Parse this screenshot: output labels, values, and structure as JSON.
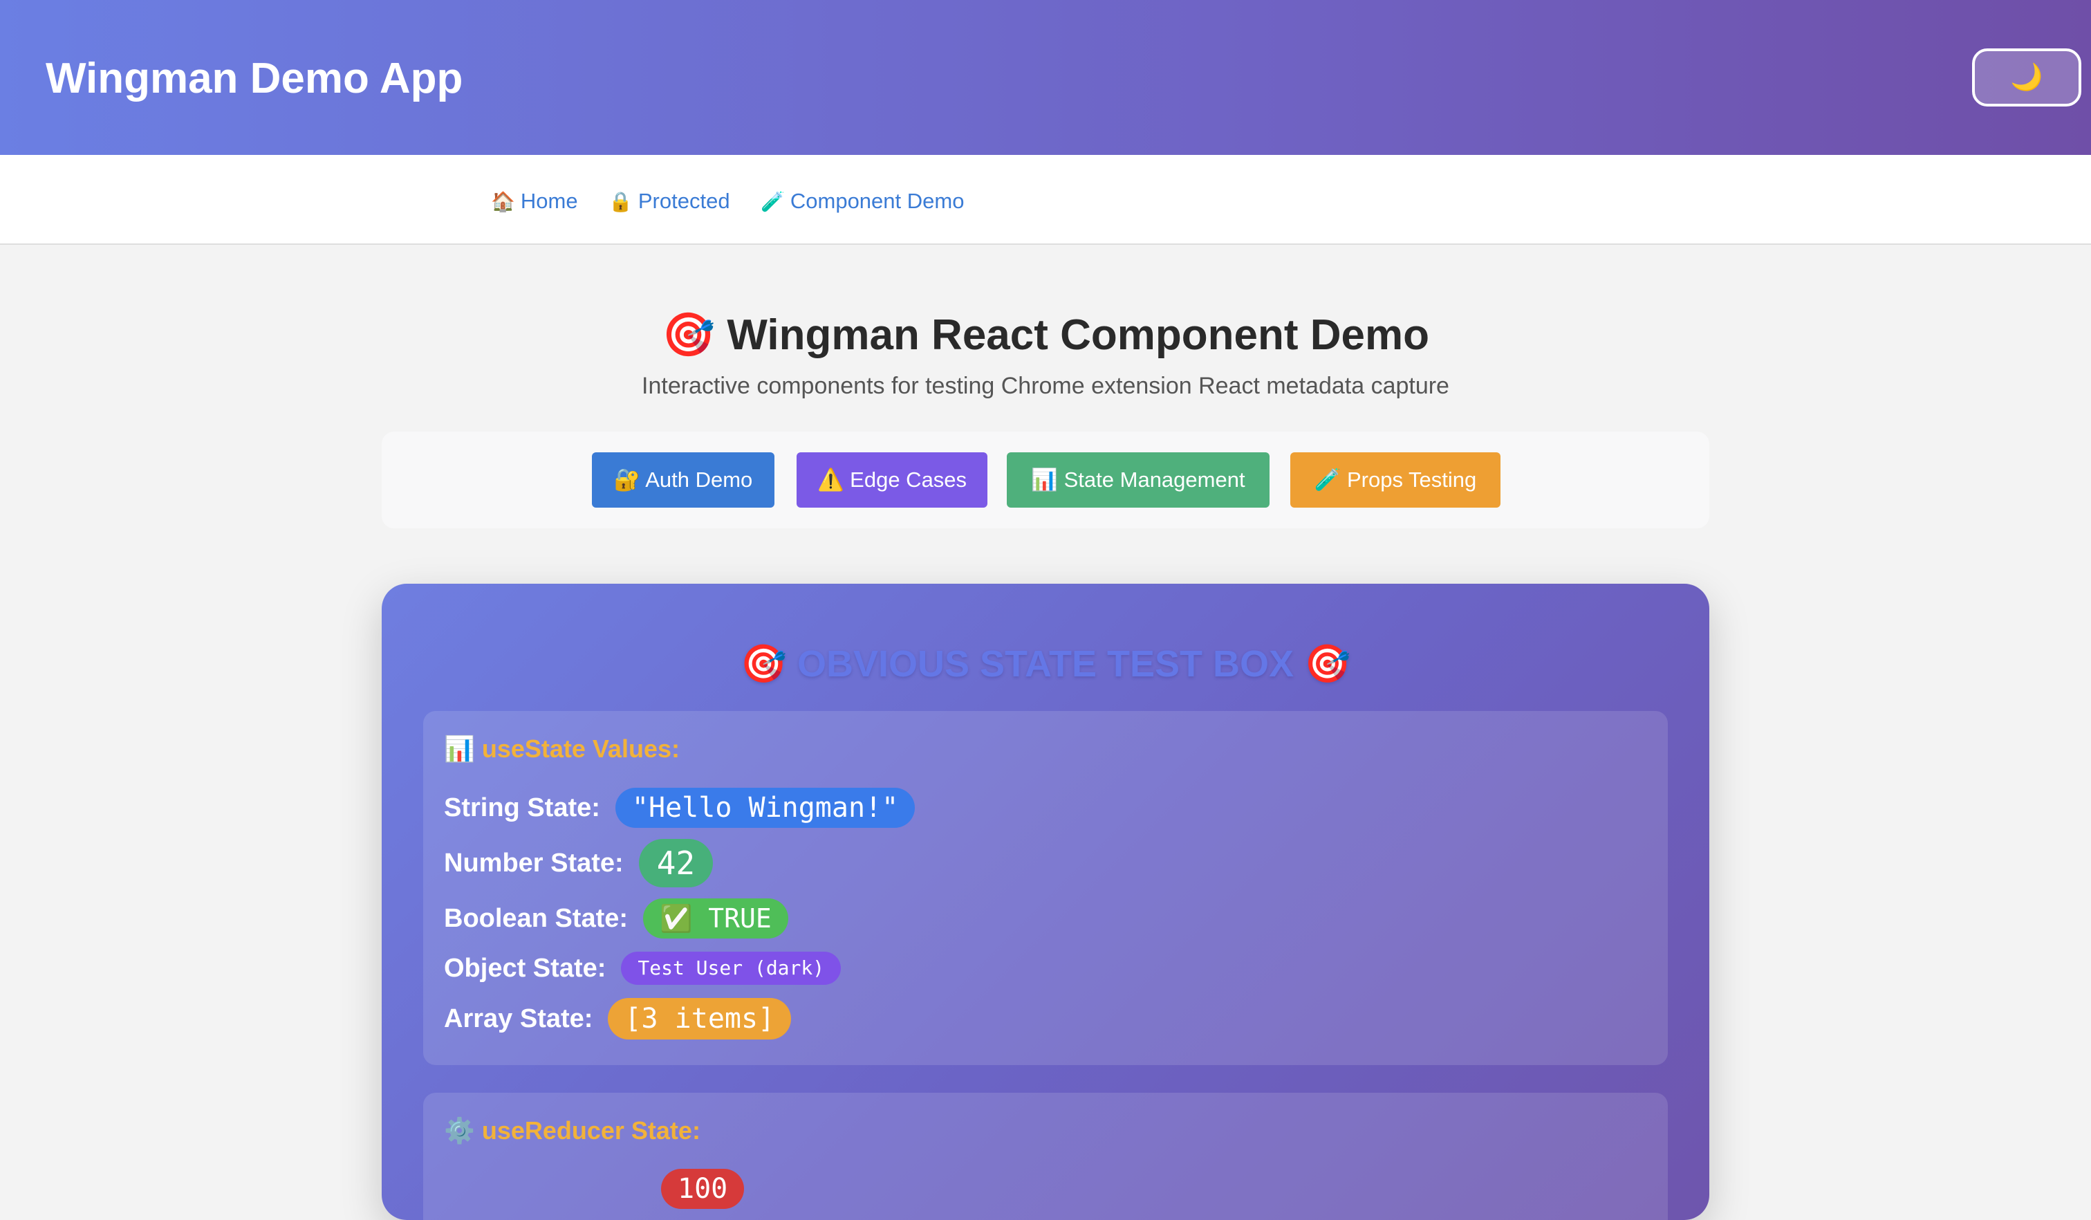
{
  "header": {
    "title": "Wingman Demo App",
    "theme_toggle_glyph": "🌙",
    "theme_toggle_icon": "moon-icon"
  },
  "nav": {
    "items": [
      {
        "icon": "🏠",
        "label": "Home"
      },
      {
        "icon": "🔒",
        "label": "Protected"
      },
      {
        "icon": "🧪",
        "label": "Component Demo"
      }
    ]
  },
  "page": {
    "title": "🎯 Wingman React Component Demo",
    "subtitle": "Interactive components for testing Chrome extension React metadata capture"
  },
  "tabs": [
    {
      "label": "🔐 Auth Demo",
      "color": "#3a7bd5"
    },
    {
      "label": "⚠️ Edge Cases",
      "color": "#7b5ae6"
    },
    {
      "label": "📊 State Management",
      "color": "#4fb07c"
    },
    {
      "label": "🧪 Props Testing",
      "color": "#ee9f33"
    }
  ],
  "card": {
    "title": "🎯 OBVIOUS STATE TEST BOX 🎯",
    "use_state": {
      "heading": "📊 useState Values:",
      "rows": [
        {
          "label": "String State:",
          "value": "\"Hello Wingman!\"",
          "color": "#3a7bea"
        },
        {
          "label": "Number State:",
          "value": "42",
          "color": "#47b07a"
        },
        {
          "label": "Boolean State:",
          "value": "✅ TRUE",
          "color": "#4fbe58"
        },
        {
          "label": "Object State:",
          "value": "Test User (dark)",
          "color": "#7f52e8"
        },
        {
          "label": "Array State:",
          "value": "[3 items]",
          "color": "#eda336"
        }
      ]
    },
    "use_reducer": {
      "heading": "⚙️ useReducer State:",
      "partial_value": "100",
      "partial_color": "#d63a3a"
    }
  }
}
